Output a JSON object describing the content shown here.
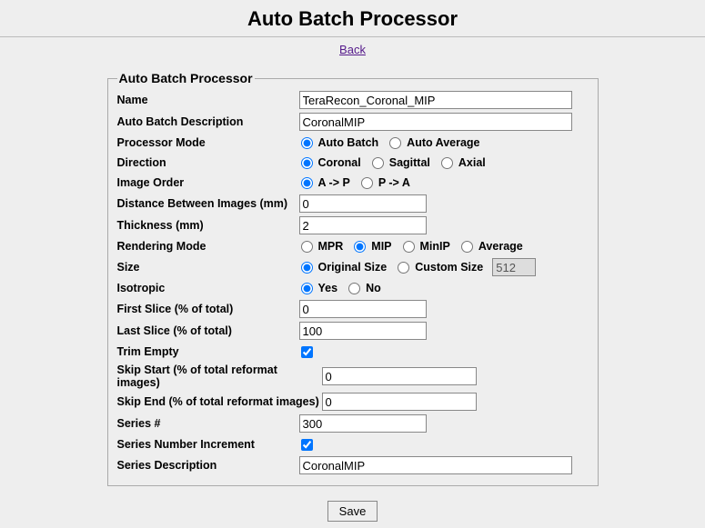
{
  "title": "Auto Batch Processor",
  "back": "Back",
  "legend": "Auto Batch Processor",
  "labels": {
    "name": "Name",
    "description": "Auto Batch Description",
    "processorMode": "Processor Mode",
    "direction": "Direction",
    "imageOrder": "Image Order",
    "distance": "Distance Between Images (mm)",
    "thickness": "Thickness (mm)",
    "renderingMode": "Rendering Mode",
    "size": "Size",
    "isotropic": "Isotropic",
    "firstSlice": "First Slice (% of total)",
    "lastSlice": "Last Slice (% of total)",
    "trimEmpty": "Trim Empty",
    "skipStart": "Skip Start (% of total reformat images)",
    "skipEnd": "Skip End (% of total reformat images)",
    "seriesNum": "Series #",
    "seriesInc": "Series Number Increment",
    "seriesDesc": "Series Description"
  },
  "values": {
    "name": "TeraRecon_Coronal_MIP",
    "description": "CoronalMIP",
    "distance": "0",
    "thickness": "2",
    "customSize": "512",
    "firstSlice": "0",
    "lastSlice": "100",
    "skipStart": "0",
    "skipEnd": "0",
    "seriesNum": "300",
    "seriesDesc": "CoronalMIP"
  },
  "options": {
    "processorMode": [
      "Auto Batch",
      "Auto Average"
    ],
    "direction": [
      "Coronal",
      "Sagittal",
      "Axial"
    ],
    "imageOrder": [
      "A -> P",
      "P -> A"
    ],
    "renderingMode": [
      "MPR",
      "MIP",
      "MinIP",
      "Average"
    ],
    "size": [
      "Original Size",
      "Custom Size"
    ],
    "isotropic": [
      "Yes",
      "No"
    ]
  },
  "save": "Save"
}
